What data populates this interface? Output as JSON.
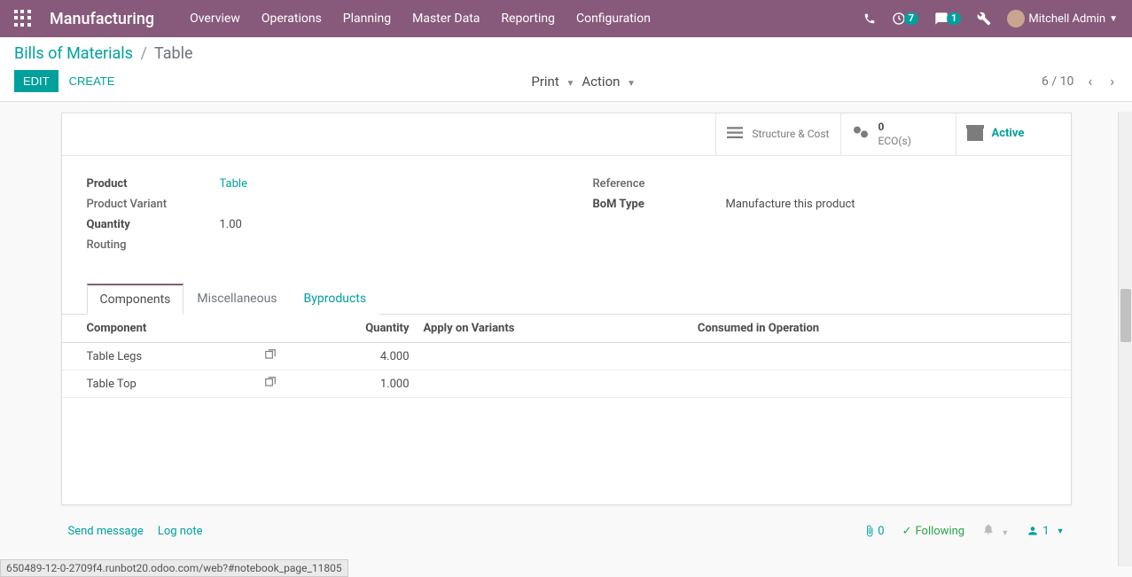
{
  "navbar": {
    "brand": "Manufacturing",
    "menu": [
      "Overview",
      "Operations",
      "Planning",
      "Master Data",
      "Reporting",
      "Configuration"
    ],
    "badge1": "7",
    "badge2": "1",
    "user": "Mitchell Admin"
  },
  "breadcrumb": {
    "link": "Bills of Materials",
    "current": "Table"
  },
  "buttons": {
    "edit": "EDIT",
    "create": "CREATE",
    "print": "Print",
    "action": "Action"
  },
  "pager": "6 / 10",
  "stat": {
    "structure": "Structure & Cost",
    "ecos_count": "0",
    "ecos_label": "ECO(s)",
    "active": "Active"
  },
  "fields": {
    "product_label": "Product",
    "product_value": "Table",
    "variant_label": "Product Variant",
    "quantity_label": "Quantity",
    "quantity_value": "1.00",
    "routing_label": "Routing",
    "reference_label": "Reference",
    "bomtype_label": "BoM Type",
    "bomtype_value": "Manufacture this product"
  },
  "tabs": {
    "components": "Components",
    "misc": "Miscellaneous",
    "byproducts": "Byproducts"
  },
  "table": {
    "headers": {
      "component": "Component",
      "quantity": "Quantity",
      "apply": "Apply on Variants",
      "consumed": "Consumed in Operation"
    },
    "rows": [
      {
        "name": "Table Legs",
        "qty": "4.000"
      },
      {
        "name": "Table Top",
        "qty": "1.000"
      }
    ]
  },
  "chatter": {
    "send": "Send message",
    "log": "Log note",
    "attach_count": "0",
    "following": "Following",
    "followers": "1"
  },
  "status_url": "650489-12-0-2709f4.runbot20.odoo.com/web?#notebook_page_11805"
}
